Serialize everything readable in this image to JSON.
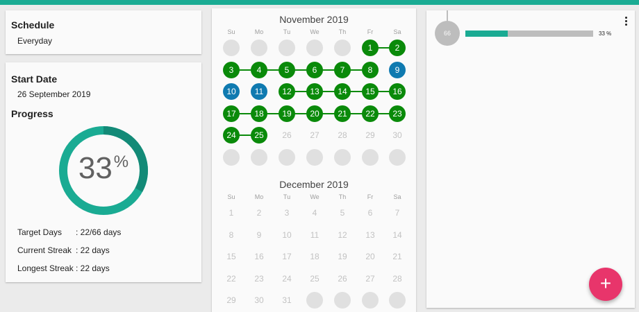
{
  "colors": {
    "accent": "#1aab93",
    "done": "#0a8a0a",
    "skip": "#0f7ab0",
    "fab": "#e8356b"
  },
  "schedule": {
    "title": "Schedule",
    "value": "Everyday"
  },
  "start": {
    "title": "Start Date",
    "value": "26 September 2019"
  },
  "progress": {
    "title": "Progress",
    "percent": 33,
    "percent_symbol": "%",
    "target_label": "Target Days",
    "target_value": ": 22/66 days",
    "current_label": "Current Streak",
    "current_value": ": 22 days",
    "longest_label": "Longest Streak",
    "longest_value": ": 22 days"
  },
  "calendar": {
    "weekdays": [
      "Su",
      "Mo",
      "Tu",
      "We",
      "Th",
      "Fr",
      "Sa"
    ],
    "months": [
      {
        "title": "November 2019",
        "days": [
          "",
          "",
          "",
          "",
          "",
          "1",
          "2",
          "3",
          "4",
          "5",
          "6",
          "7",
          "8",
          "9",
          "10",
          "11",
          "12",
          "13",
          "14",
          "15",
          "16",
          "17",
          "18",
          "19",
          "20",
          "21",
          "22",
          "23",
          "24",
          "25",
          "26",
          "27",
          "28",
          "29",
          "30",
          "",
          "",
          "",
          "",
          "",
          "",
          ""
        ],
        "states": [
          "empty",
          "empty",
          "empty",
          "empty",
          "empty",
          "done",
          "done",
          "done",
          "done",
          "done",
          "done",
          "done",
          "done",
          "skip",
          "skip",
          "skip",
          "done",
          "done",
          "done",
          "done",
          "done",
          "done",
          "done",
          "done",
          "done",
          "done",
          "done",
          "done",
          "done",
          "done",
          "future",
          "future",
          "future",
          "future",
          "future",
          "empty",
          "empty",
          "empty",
          "empty",
          "empty",
          "empty",
          "empty"
        ]
      },
      {
        "title": "December 2019",
        "days": [
          "1",
          "2",
          "3",
          "4",
          "5",
          "6",
          "7",
          "8",
          "9",
          "10",
          "11",
          "12",
          "13",
          "14",
          "15",
          "16",
          "17",
          "18",
          "19",
          "20",
          "21",
          "22",
          "23",
          "24",
          "25",
          "26",
          "27",
          "28",
          "29",
          "30",
          "31",
          "",
          "",
          "",
          ""
        ],
        "states": [
          "future",
          "future",
          "future",
          "future",
          "future",
          "future",
          "future",
          "future",
          "future",
          "future",
          "future",
          "future",
          "future",
          "future",
          "future",
          "future",
          "future",
          "future",
          "future",
          "future",
          "future",
          "future",
          "future",
          "future",
          "future",
          "future",
          "future",
          "future",
          "future",
          "future",
          "future",
          "empty",
          "empty",
          "empty",
          "empty"
        ]
      }
    ]
  },
  "habit": {
    "target": "66",
    "progress_fraction": 0.33,
    "percent_label": "33 %"
  },
  "fab": {
    "label": "+"
  }
}
